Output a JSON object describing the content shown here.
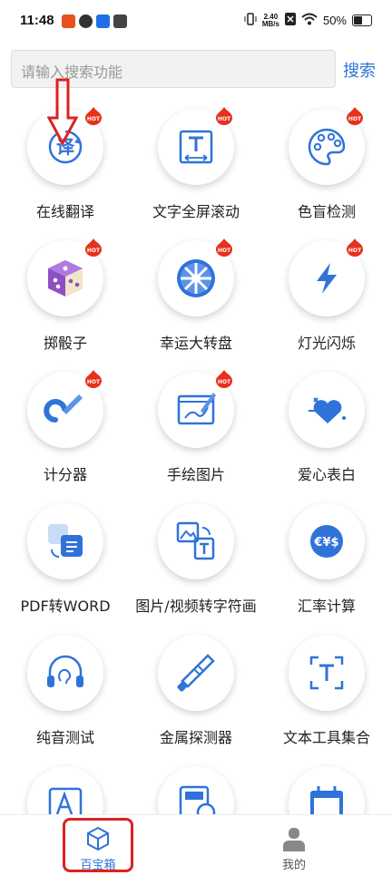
{
  "status_bar": {
    "time": "11:48",
    "net_speed_top": "2.40",
    "net_speed_bottom": "MB/s",
    "battery": "50%"
  },
  "search": {
    "placeholder": "请输入搜索功能",
    "button_label": "搜索"
  },
  "tools": [
    {
      "label": "在线翻译",
      "icon": "translate-icon",
      "hot": true
    },
    {
      "label": "文字全屏滚动",
      "icon": "text-scroll-icon",
      "hot": true
    },
    {
      "label": "色盲检测",
      "icon": "palette-icon",
      "hot": true
    },
    {
      "label": "掷骰子",
      "icon": "dice-icon",
      "hot": true
    },
    {
      "label": "幸运大转盘",
      "icon": "wheel-icon",
      "hot": true
    },
    {
      "label": "灯光闪烁",
      "icon": "lightning-icon",
      "hot": true
    },
    {
      "label": "计分器",
      "icon": "counter-icon",
      "hot": true
    },
    {
      "label": "手绘图片",
      "icon": "drawing-icon",
      "hot": true
    },
    {
      "label": "爱心表白",
      "icon": "heart-icon",
      "hot": false
    },
    {
      "label": "PDF转WORD",
      "icon": "pdf-convert-icon",
      "hot": false
    },
    {
      "label": "图片/视频转字符画",
      "icon": "image-to-text-icon",
      "hot": false
    },
    {
      "label": "汇率计算",
      "icon": "currency-icon",
      "hot": false
    },
    {
      "label": "纯音测试",
      "icon": "headphone-icon",
      "hot": false
    },
    {
      "label": "金属探测器",
      "icon": "metal-detector-icon",
      "hot": false
    },
    {
      "label": "文本工具集合",
      "icon": "text-tools-icon",
      "hot": false
    },
    {
      "label": "",
      "icon": "font-icon",
      "hot": false
    },
    {
      "label": "",
      "icon": "calculator-icon",
      "hot": false
    },
    {
      "label": "",
      "icon": "calendar-icon",
      "hot": false
    }
  ],
  "hot_badge": "HOT",
  "nav": {
    "tab_toolbox": "百宝箱",
    "tab_mine": "我的"
  },
  "colors": {
    "accent": "#2f73d9",
    "hot_red": "#e8301c",
    "annotation_red": "#e02020"
  }
}
